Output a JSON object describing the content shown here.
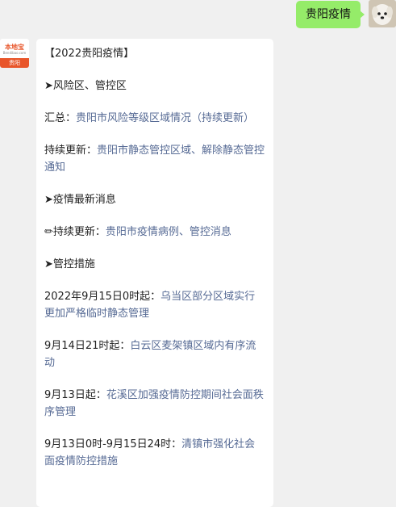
{
  "user_message": "贵阳疫情",
  "bot_avatar": {
    "brand": "本地宝",
    "domain": "Bendibao.com",
    "city": "贵阳"
  },
  "article": {
    "title": "【2022贵阳疫情】",
    "sections": [
      {
        "heading": "➤风险区、管控区"
      },
      {
        "label": "汇总：",
        "link": "贵阳市风险等级区域情况（持续更新）"
      },
      {
        "label": "持续更新：",
        "link": "贵阳市静态管控区域、解除静态管控通知"
      },
      {
        "heading": "➤疫情最新消息"
      },
      {
        "label": "✏持续更新：",
        "link": "贵阳市疫情病例、管控消息"
      },
      {
        "heading": "➤管控措施"
      },
      {
        "label": "2022年9月15日0时起：",
        "link": "乌当区部分区域实行更加严格临时静态管理"
      },
      {
        "label": "9月14日21时起：",
        "link": "白云区麦架镇区域内有序流动"
      },
      {
        "label": "9月13日起：",
        "link": "花溪区加强疫情防控期间社会面秩序管理"
      },
      {
        "label": "9月13日0时-9月15日24时：",
        "link": "清镇市强化社会面疫情防控措施"
      }
    ]
  },
  "colors": {
    "user_bubble": "#95ec69",
    "link": "#576b95",
    "brand_orange": "#e8552a"
  }
}
